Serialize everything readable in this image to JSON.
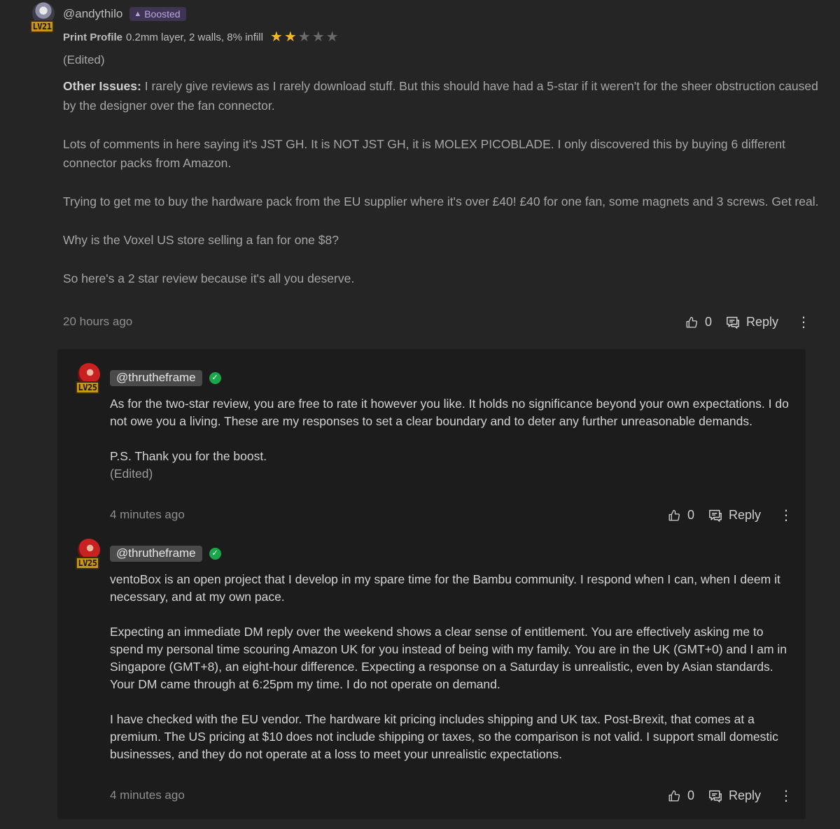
{
  "top_comment": {
    "avatar_level": "LV21",
    "username": "@andythilo",
    "boost_badge": "Boosted",
    "profile_label": "Print Profile",
    "profile_value": "0.2mm layer, 2 walls, 8% infill",
    "rating": {
      "value": 2,
      "max": 5
    },
    "edited": "(Edited)",
    "issues_label": "Other Issues:",
    "paragraphs": [
      "I rarely give reviews as I rarely download stuff. But this should have had a 5-star if it weren't for the sheer obstruction caused by the designer over the fan connector.",
      "Lots of comments in here saying it's JST GH. It is NOT JST GH, it is MOLEX PICOBLADE. I only discovered this by buying 6 different connector packs from Amazon.",
      "Trying to get me to buy the hardware pack from the EU supplier where it's over £40! £40 for one fan, some magnets and 3 screws. Get real.",
      "Why is the Voxel US store selling a fan for one $8?",
      "So here's a 2 star review because it's all you deserve."
    ],
    "time": "20 hours ago",
    "likes": "0",
    "reply_label": "Reply"
  },
  "replies": [
    {
      "avatar_level": "LV25",
      "username": "@thrutheframe",
      "paragraphs": [
        "As for the two-star review, you are free to rate it however you like. It holds no significance beyond your own expectations. I do not owe you a living. These are my responses to set a clear boundary and to deter any further unreasonable demands.",
        "P.S. Thank you for the boost."
      ],
      "edited": "(Edited)",
      "time": "4 minutes ago",
      "likes": "0",
      "reply_label": "Reply"
    },
    {
      "avatar_level": "LV25",
      "username": "@thrutheframe",
      "paragraphs": [
        "ventoBox is an open project that I develop in my spare time for the Bambu community. I respond when I can, when I deem it necessary, and at my own pace.",
        "Expecting an immediate DM reply over the weekend shows a clear sense of entitlement. You are effectively asking me to spend my personal time scouring Amazon UK for you instead of being with my family. You are in the UK (GMT+0) and I am in Singapore (GMT+8), an eight-hour difference. Expecting a response on a Saturday is unrealistic, even by Asian standards. Your DM came through at 6:25pm my time. I do not operate on demand.",
        "I have checked with the EU vendor. The hardware kit pricing includes shipping and UK tax. Post-Brexit, that comes at a premium. The US pricing at $10 does not include shipping or taxes, so the comparison is not valid. I support small domestic businesses, and they do not operate at a loss to meet your unrealistic expectations."
      ],
      "time": "4 minutes ago",
      "likes": "0",
      "reply_label": "Reply"
    }
  ],
  "colors": {
    "background": "#252525",
    "reply_box": "#1c1c1c",
    "star_on": "#f5b820",
    "star_off": "#6a6a6a",
    "boost_badge_bg": "#3f3552",
    "verified": "#1aa64a"
  },
  "icons": [
    "thumbs-up-icon",
    "reply-icon",
    "more-vertical-icon",
    "verified-icon",
    "rocket-icon",
    "star-icon"
  ]
}
